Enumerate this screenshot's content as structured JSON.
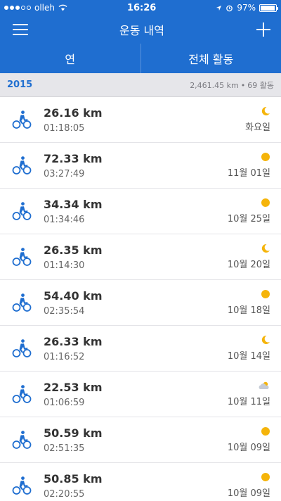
{
  "status": {
    "carrier": "olleh",
    "time": "16:26",
    "battery": "97%"
  },
  "nav": {
    "title": "운동 내역"
  },
  "tabs": [
    {
      "label": "연"
    },
    {
      "label": "전체 활동"
    }
  ],
  "section": {
    "year": "2015",
    "distance_total": "2,461.45 km",
    "separator": "•",
    "activity_count": "69 활동"
  },
  "activities": [
    {
      "distance": "26.16 km",
      "duration": "01:18:05",
      "date": "화요일",
      "weather": "moon-icon"
    },
    {
      "distance": "72.33 km",
      "duration": "03:27:49",
      "date": "11월 01일",
      "weather": "sun-icon"
    },
    {
      "distance": "34.34 km",
      "duration": "01:34:46",
      "date": "10월 25일",
      "weather": "sun-icon"
    },
    {
      "distance": "26.35 km",
      "duration": "01:14:30",
      "date": "10월 20일",
      "weather": "moon-icon"
    },
    {
      "distance": "54.40 km",
      "duration": "02:35:54",
      "date": "10월 18일",
      "weather": "sun-icon"
    },
    {
      "distance": "26.33 km",
      "duration": "01:16:52",
      "date": "10월 14일",
      "weather": "moon-icon"
    },
    {
      "distance": "22.53 km",
      "duration": "01:06:59",
      "date": "10월 11일",
      "weather": "cloud-icon"
    },
    {
      "distance": "50.59 km",
      "duration": "02:51:35",
      "date": "10월 09일",
      "weather": "sun-icon"
    },
    {
      "distance": "50.85 km",
      "duration": "02:20:55",
      "date": "10월 09일",
      "weather": "sun-icon"
    }
  ],
  "colors": {
    "brand": "#1f6ed0",
    "sun": "#f5b40a",
    "moon": "#f5b40a",
    "cloud": "#c5cbd6"
  }
}
